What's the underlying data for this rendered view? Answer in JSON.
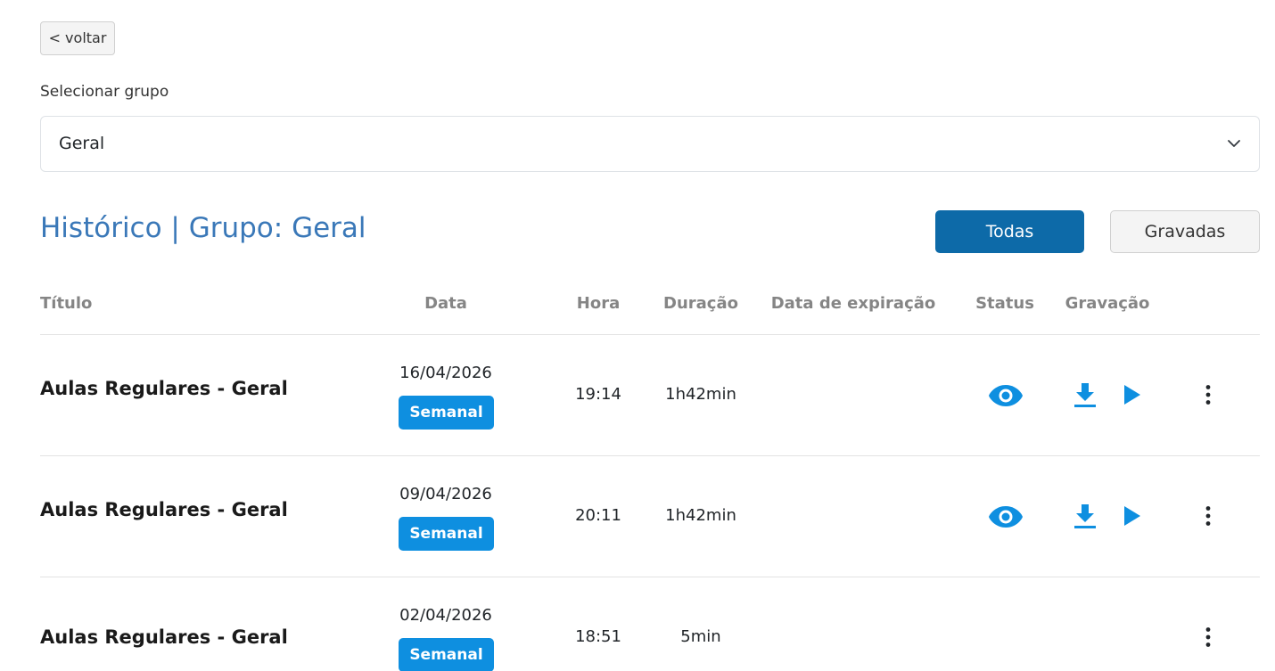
{
  "back_button": {
    "label": "< voltar"
  },
  "group_select": {
    "label": "Selecionar grupo",
    "value": "Geral",
    "icon": "chevron-down-icon"
  },
  "history": {
    "title": "Histórico | Grupo: Geral",
    "filter_buttons": {
      "all": "Todas",
      "recorded": "Gravadas"
    }
  },
  "table": {
    "columns": {
      "titulo": "Título",
      "data": "Data",
      "hora": "Hora",
      "duracao": "Duração",
      "expiracao": "Data de expiração",
      "status": "Status",
      "gravacao": "Gravação"
    },
    "rows": [
      {
        "title": "Aulas Regulares - Geral",
        "date": "16/04/2026",
        "badge": "Semanal",
        "time": "19:14",
        "duration": "1h42min",
        "expiration": "",
        "status_icon": "eye-icon",
        "recording_icons": [
          "download-icon",
          "play-icon"
        ]
      },
      {
        "title": "Aulas Regulares - Geral",
        "date": "09/04/2026",
        "badge": "Semanal",
        "time": "20:11",
        "duration": "1h42min",
        "expiration": "",
        "status_icon": "eye-icon",
        "recording_icons": [
          "download-icon",
          "play-icon"
        ]
      },
      {
        "title": "Aulas Regulares - Geral",
        "date": "02/04/2026",
        "badge": "Semanal",
        "time": "18:51",
        "duration": "5min",
        "expiration": ""
      }
    ]
  },
  "colors": {
    "title_blue": "#3a78b8",
    "primary_button": "#0d6aa8",
    "badge_blue": "#0e8fe0",
    "icon_blue": "#0e8fe0"
  }
}
